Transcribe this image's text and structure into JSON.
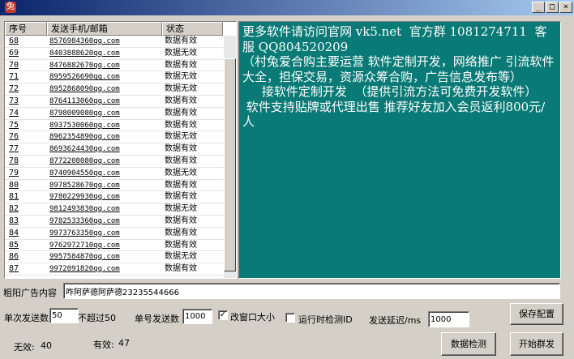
{
  "window": {
    "controls": {
      "minimize": "_",
      "maximize": "□",
      "close": "×"
    }
  },
  "list": {
    "columns": [
      "序号",
      "发送手机/邮箱",
      "状态"
    ],
    "rows": [
      {
        "idx": "68",
        "contact": "8576984360qq.com",
        "status": "数据有效"
      },
      {
        "idx": "69",
        "contact": "8403888620qq.com",
        "status": "数据无效"
      },
      {
        "idx": "70",
        "contact": "8476882670qq.com",
        "status": "数据有效"
      },
      {
        "idx": "71",
        "contact": "8959526690qq.com",
        "status": "数据无效"
      },
      {
        "idx": "72",
        "contact": "8952868090qq.com",
        "status": "数据无效"
      },
      {
        "idx": "73",
        "contact": "8764113060qq.com",
        "status": "数据有效"
      },
      {
        "idx": "74",
        "contact": "8798009080qq.com",
        "status": "数据有效"
      },
      {
        "idx": "75",
        "contact": "8937530060qq.com",
        "status": "数据有效"
      },
      {
        "idx": "76",
        "contact": "8962354890qq.com",
        "status": "数据无效"
      },
      {
        "idx": "77",
        "contact": "8693624430qq.com",
        "status": "数据有效"
      },
      {
        "idx": "78",
        "contact": "8772208080qq.com",
        "status": "数据有效"
      },
      {
        "idx": "79",
        "contact": "8740904550qq.com",
        "status": "数据无效"
      },
      {
        "idx": "80",
        "contact": "8978528670qq.com",
        "status": "数据有效"
      },
      {
        "idx": "81",
        "contact": "9780229930qq.com",
        "status": "数据有效"
      },
      {
        "idx": "82",
        "contact": "9812493830qq.com",
        "status": "数据无效"
      },
      {
        "idx": "83",
        "contact": "9782533360qq.com",
        "status": "数据有效"
      },
      {
        "idx": "84",
        "contact": "9973763350qq.com",
        "status": "数据有效"
      },
      {
        "idx": "85",
        "contact": "9762972710qq.com",
        "status": "数据有效"
      },
      {
        "idx": "86",
        "contact": "9957584870qq.com",
        "status": "数据无效"
      },
      {
        "idx": "87",
        "contact": "9972091820qq.com",
        "status": "数据有效"
      }
    ],
    "scroll_position": 0.77
  },
  "info_text": "更多软件请访问官网 vk5.net  官方群 1081274711  客服 QQ804520209\n（村兔爱合购主要运营 软件定制开发，网络推广 引流软件大全，担保交易，资源众筹合购，广告信息发布等）\n     接软件定制开发  （提供引流方法可免费开发软件）\n 软件支持贴牌或代理出售 推荐好友加入会员返利800元/人",
  "form": {
    "ad_label": "粗阳广告内容",
    "ad_value": "咋阿萨德阿萨德23235544666",
    "batch_label": "单次发送数",
    "batch_value": "50",
    "batch_hint": "不超过50",
    "single_label": "单号发送数",
    "single_value": "1000",
    "resize_label": "改窗口大小",
    "resize_checked": "✓",
    "detect_label": "运行时检测ID",
    "detect_checked": "",
    "delay_label": "发送延迟/ms",
    "delay_value": "1000",
    "save_button": "保存配置",
    "check_button": "数据检测",
    "start_button": "开始群发",
    "invalid_label": "无效:",
    "invalid_count": "40",
    "valid_label": "有效:",
    "valid_count": "47"
  },
  "colors": {
    "info_bg": "#0a7a76",
    "title_start": "#0a246a",
    "title_end": "#a6caf0"
  },
  "icons": {
    "app": "app-rabbit-icon"
  }
}
